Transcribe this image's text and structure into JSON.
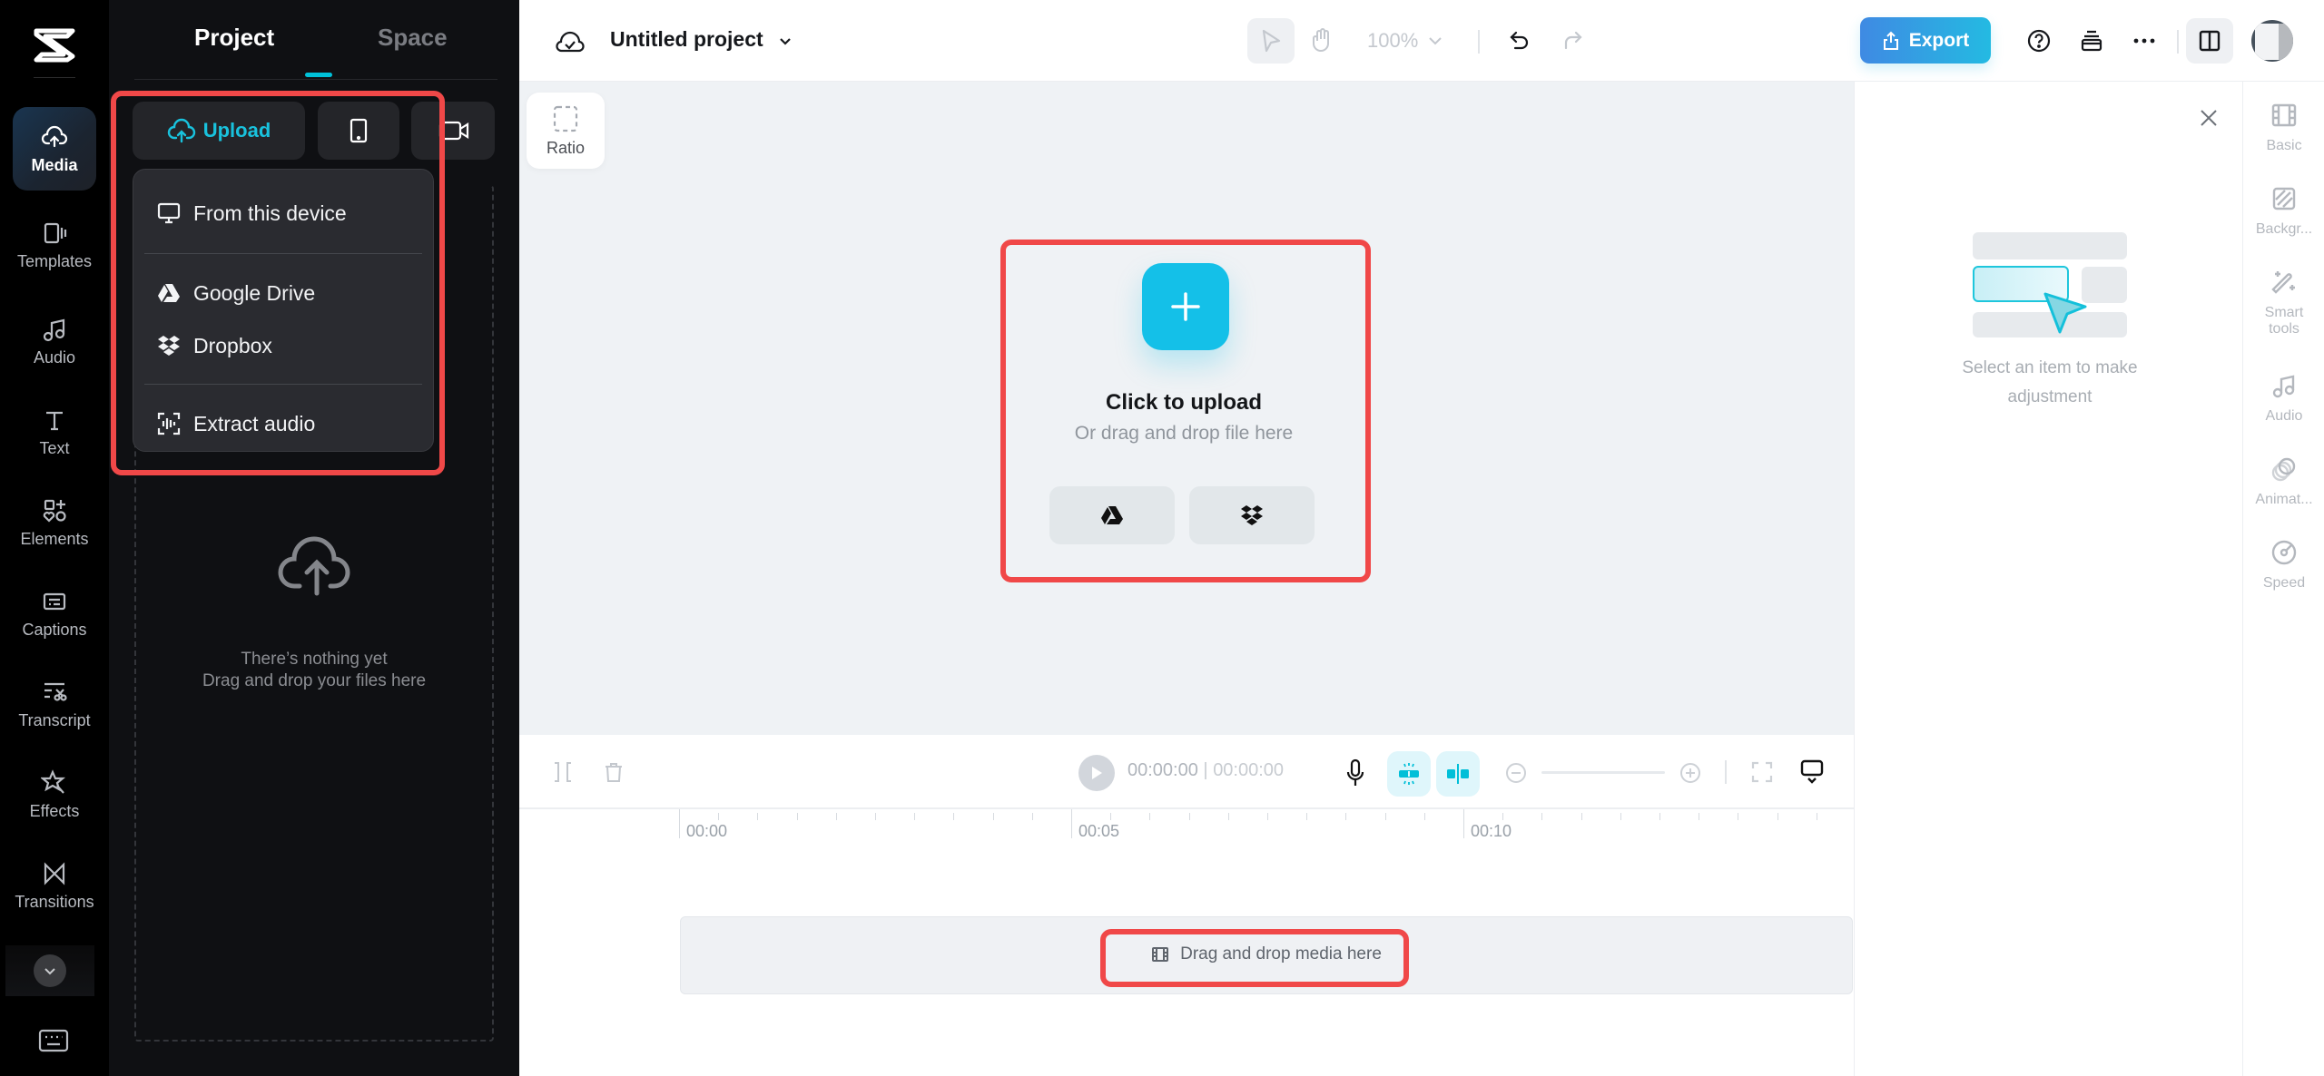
{
  "rail": {
    "items": [
      {
        "label": "Media",
        "icon": "cloud-upload-icon",
        "active": true
      },
      {
        "label": "Templates",
        "icon": "templates-icon"
      },
      {
        "label": "Audio",
        "icon": "music-note-icon"
      },
      {
        "label": "Text",
        "icon": "text-icon"
      },
      {
        "label": "Elements",
        "icon": "elements-icon"
      },
      {
        "label": "Captions",
        "icon": "captions-icon"
      },
      {
        "label": "Transcript",
        "icon": "transcript-icon"
      },
      {
        "label": "Effects",
        "icon": "effects-icon"
      },
      {
        "label": "Transitions",
        "icon": "transitions-icon"
      }
    ]
  },
  "panel": {
    "tabs": [
      {
        "label": "Project",
        "active": true
      },
      {
        "label": "Space"
      }
    ],
    "upload_label": "Upload",
    "menu": [
      {
        "label": "From this device",
        "icon": "monitor-icon"
      },
      {
        "label": "Google Drive",
        "icon": "google-drive-icon"
      },
      {
        "label": "Dropbox",
        "icon": "dropbox-icon"
      },
      {
        "label": "Extract audio",
        "icon": "extract-audio-icon"
      }
    ],
    "empty_line1": "There’s nothing yet",
    "empty_line2": "Drag and drop your files here"
  },
  "topbar": {
    "project_title": "Untitled project",
    "zoom": "100%",
    "export_label": "Export"
  },
  "canvas": {
    "ratio_label": "Ratio",
    "upload_title": "Click to upload",
    "upload_sub": "Or drag and drop file here"
  },
  "timeline": {
    "current_time": "00:00:00",
    "total_time": "00:00:00",
    "ruler": [
      "00:00",
      "00:05",
      "00:10"
    ],
    "track_placeholder": "Drag and drop media here"
  },
  "props": {
    "message": "Select an item to make adjustment",
    "tools": [
      {
        "label": "Basic",
        "icon": "film-icon"
      },
      {
        "label": "Backgr...",
        "icon": "background-icon"
      },
      {
        "label": "Smart tools",
        "icon": "magic-wand-icon"
      },
      {
        "label": "Audio",
        "icon": "music-note-icon"
      },
      {
        "label": "Animat...",
        "icon": "animation-icon"
      },
      {
        "label": "Speed",
        "icon": "speed-icon"
      }
    ]
  },
  "colors": {
    "accent": "#00c1d9",
    "export_start": "#3f8ae3",
    "export_end": "#24bae2",
    "highlight": "#f04848"
  }
}
